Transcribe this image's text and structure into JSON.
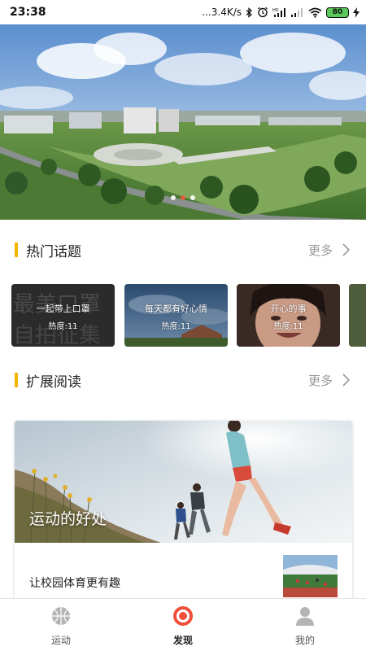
{
  "status_bar": {
    "time": "23:38",
    "network_speed": "...3.4K/s",
    "battery_level": "80",
    "icons": [
      "bluetooth-icon",
      "alarm-icon",
      "hd-signal-icon",
      "signal-icon",
      "wifi-icon",
      "battery-icon",
      "charging-icon"
    ]
  },
  "banner": {
    "slide_count": 3,
    "active_slide": 2
  },
  "hot_topics": {
    "title": "热门话题",
    "more_label": "更多",
    "items": [
      {
        "title": "一起带上口罩",
        "heat": "热度:11",
        "background_text": "最美口罩 自拍征集"
      },
      {
        "title": "每天都有好心情",
        "heat": "热度:11"
      },
      {
        "title": "开心的事",
        "heat": "热度:11"
      }
    ]
  },
  "extended_reading": {
    "title": "扩展阅读",
    "more_label": "更多",
    "feature": {
      "caption": "运动的好处",
      "item_title": "让校园体育更有趣"
    }
  },
  "bottom_nav": {
    "items": [
      {
        "label": "运动",
        "icon": "basketball-icon"
      },
      {
        "label": "发现",
        "icon": "target-icon"
      },
      {
        "label": "我的",
        "icon": "user-icon"
      }
    ],
    "active_index": 1
  },
  "colors": {
    "accent_bar": "#f5b400",
    "active_dot": "#f05a3c",
    "nav_active": "#f0503c",
    "nav_inactive": "#b5b5b5",
    "more_text": "#999999"
  }
}
